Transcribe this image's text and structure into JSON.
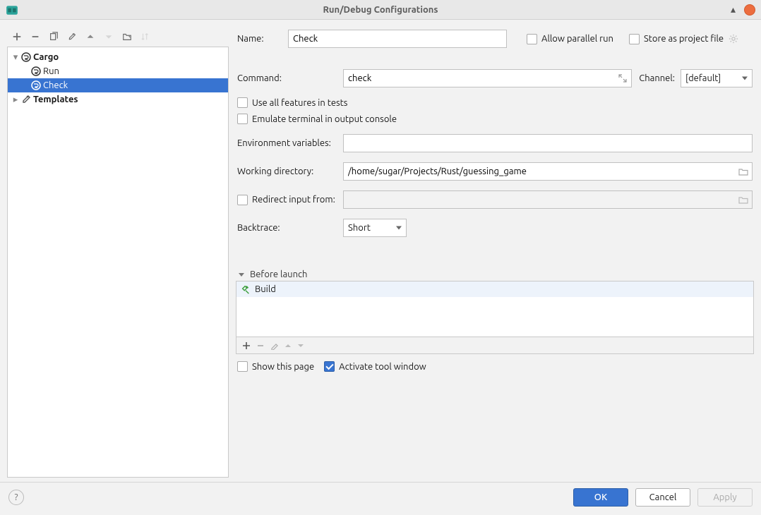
{
  "window": {
    "title": "Run/Debug Configurations"
  },
  "tree": {
    "cargo_label": "Cargo",
    "run_label": "Run",
    "check_label": "Check",
    "templates_label": "Templates"
  },
  "form": {
    "name_label": "Name:",
    "name_value": "Check",
    "allow_parallel_label": "Allow parallel run",
    "store_project_label": "Store as project file",
    "command_label": "Command:",
    "command_value": "check",
    "channel_label": "Channel:",
    "channel_value": "[default]",
    "use_all_features_label": "Use all features in tests",
    "emulate_terminal_label": "Emulate terminal in output console",
    "env_vars_label": "Environment variables:",
    "env_vars_value": "",
    "working_dir_label": "Working directory:",
    "working_dir_value": "/home/sugar/Projects/Rust/guessing_game",
    "redirect_input_label": "Redirect input from:",
    "redirect_input_value": "",
    "backtrace_label": "Backtrace:",
    "backtrace_value": "Short",
    "before_launch_label": "Before launch",
    "build_label": "Build",
    "show_page_label": "Show this page",
    "activate_tool_label": "Activate tool window"
  },
  "footer": {
    "ok": "OK",
    "cancel": "Cancel",
    "apply": "Apply"
  }
}
